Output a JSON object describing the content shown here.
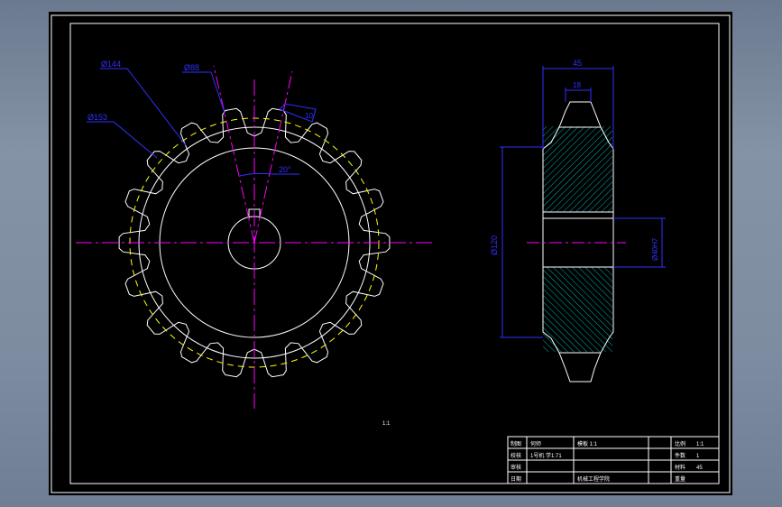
{
  "colors": {
    "background": "#000000",
    "frame": "#ffffff",
    "geometry": "#ffffff",
    "pitch_circle": "#ffff00",
    "centerline": "#ff00ff",
    "dimension": "#3030ff",
    "hatch": "#00b0b0"
  },
  "front_view": {
    "teeth": 18,
    "dim_root_dia": "Ø144",
    "dim_outer_dia": "Ø153",
    "dim_tooth": "Ø88",
    "dim_tooth_width": "10",
    "angle": "20°"
  },
  "side_view": {
    "dim_width": "45",
    "dim_hub_width": "18",
    "dim_hub_dia": "Ø120",
    "dim_bore_dia": "Ø40H7"
  },
  "scale_note": "1:1",
  "title_block": {
    "r1": [
      "制图",
      "何师",
      "模板 1:1",
      "",
      "比例",
      "1:1"
    ],
    "r2": [
      "校核",
      "1号机 学1:71",
      "",
      "",
      "件数",
      "1"
    ],
    "r3": [
      "审核",
      "",
      "",
      "",
      "材料",
      "45"
    ],
    "r4": [
      "日期",
      "",
      "机械工程学院",
      "",
      "重量",
      ""
    ]
  }
}
